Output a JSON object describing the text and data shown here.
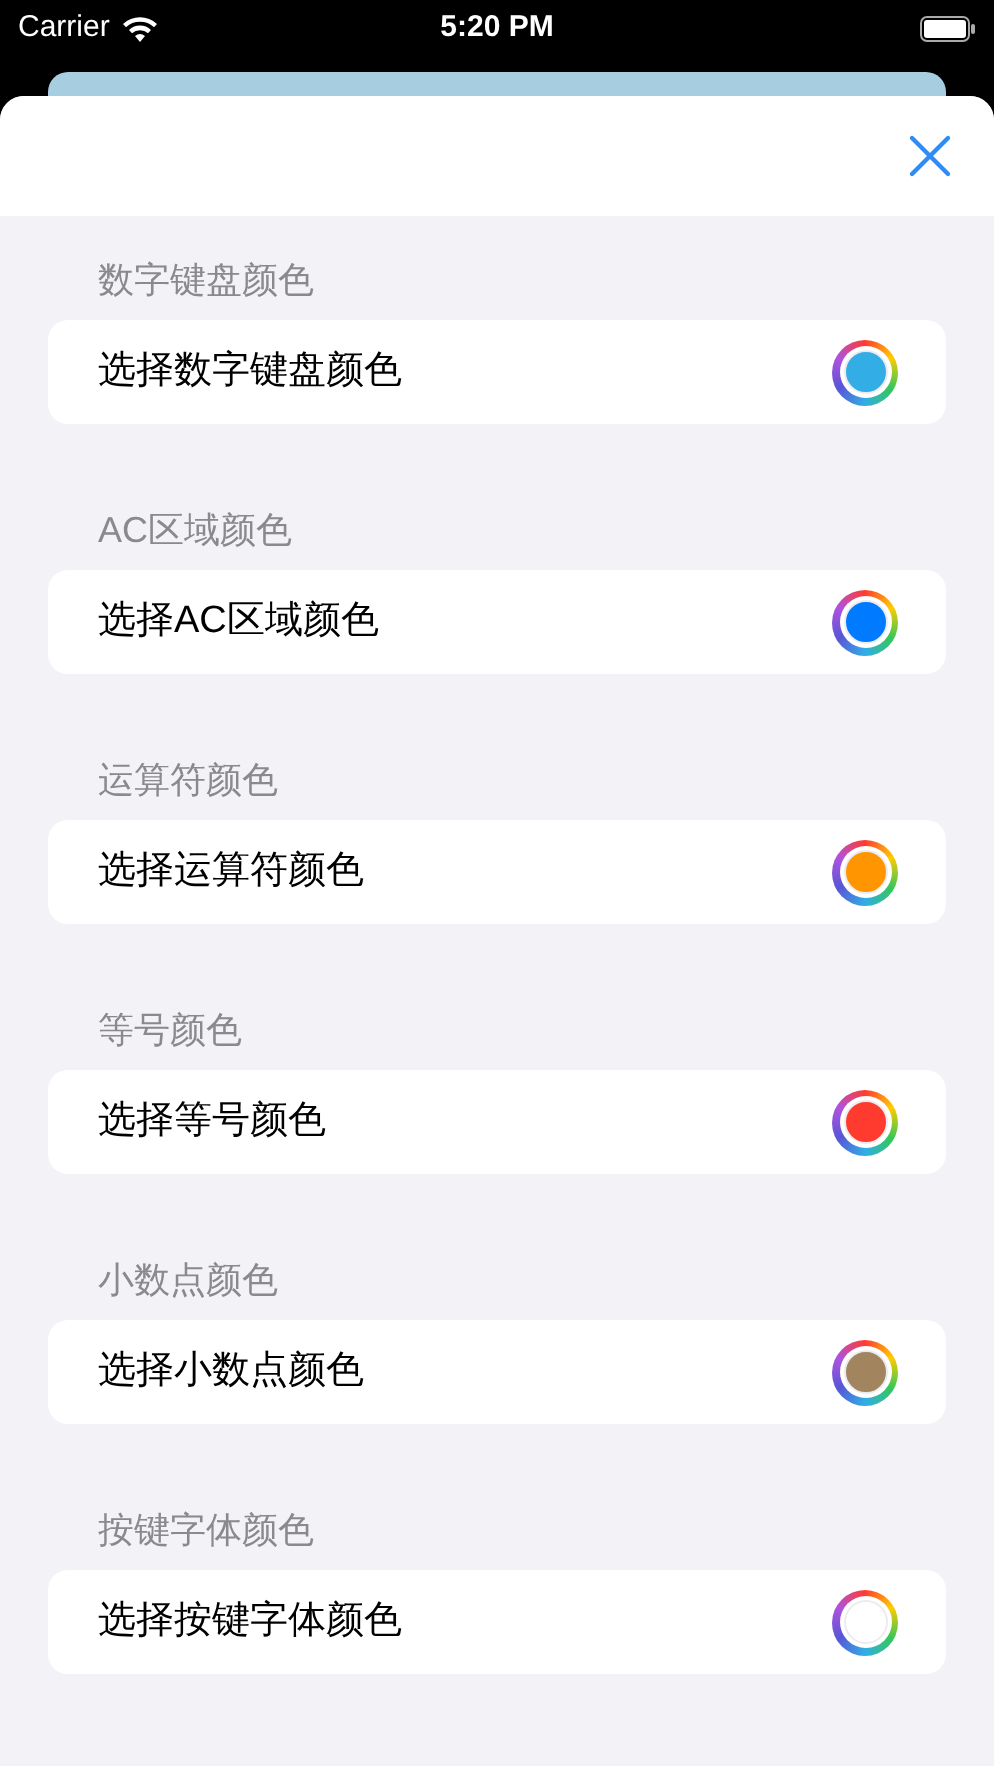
{
  "status_bar": {
    "carrier": "Carrier",
    "time": "5:20 PM"
  },
  "sections": [
    {
      "header": "数字键盘颜色",
      "label": "选择数字键盘颜色",
      "color": "#32ade6"
    },
    {
      "header": "AC区域颜色",
      "label": "选择AC区域颜色",
      "color": "#007aff"
    },
    {
      "header": "运算符颜色",
      "label": "选择运算符颜色",
      "color": "#ff9500"
    },
    {
      "header": "等号颜色",
      "label": "选择等号颜色",
      "color": "#ff3b30"
    },
    {
      "header": "小数点颜色",
      "label": "选择小数点颜色",
      "color": "#a2845e"
    },
    {
      "header": "按键字体颜色",
      "label": "选择按键字体颜色",
      "color": "#ffffff"
    }
  ]
}
